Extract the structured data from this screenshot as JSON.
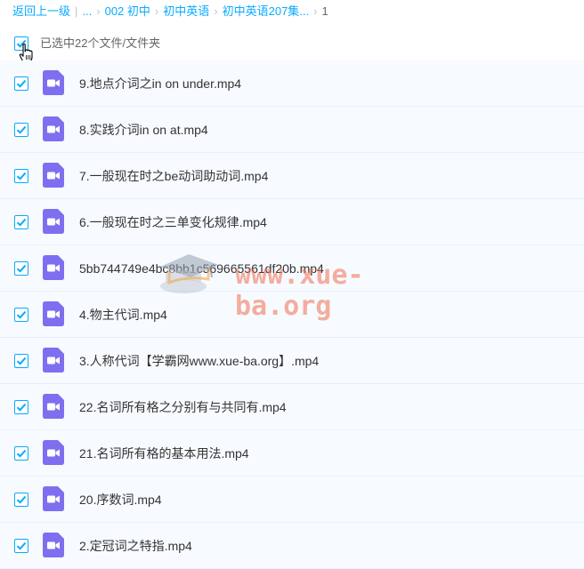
{
  "breadcrumb": {
    "back": "返回上一级",
    "ellipsis": "...",
    "items": [
      "002 初中",
      "初中英语",
      "初中英语207集..."
    ],
    "current": "1"
  },
  "selection": {
    "label": "已选中22个文件/文件夹"
  },
  "files": [
    "9.地点介词之in on under.mp4",
    "8.实践介词in on at.mp4",
    "7.一般现在时之be动词助动词.mp4",
    "6.一般现在时之三单变化规律.mp4",
    "5bb744749e4bc8bb1c569665561df20b.mp4",
    "4.物主代词.mp4",
    "3.人称代词【学霸网www.xue-ba.org】.mp4",
    "22.名词所有格之分别有与共同有.mp4",
    "21.名词所有格的基本用法.mp4",
    "20.序数词.mp4",
    "2.定冠词之特指.mp4"
  ],
  "watermark": {
    "text": "www.xue-ba.org"
  },
  "colors": {
    "accent": "#09aaff",
    "video_icon": "#7e6ff0",
    "row_bg": "#f7fbff"
  },
  "icons": {
    "file": "video-file-icon",
    "check": "check-icon",
    "cursor": "hand-cursor-icon"
  }
}
